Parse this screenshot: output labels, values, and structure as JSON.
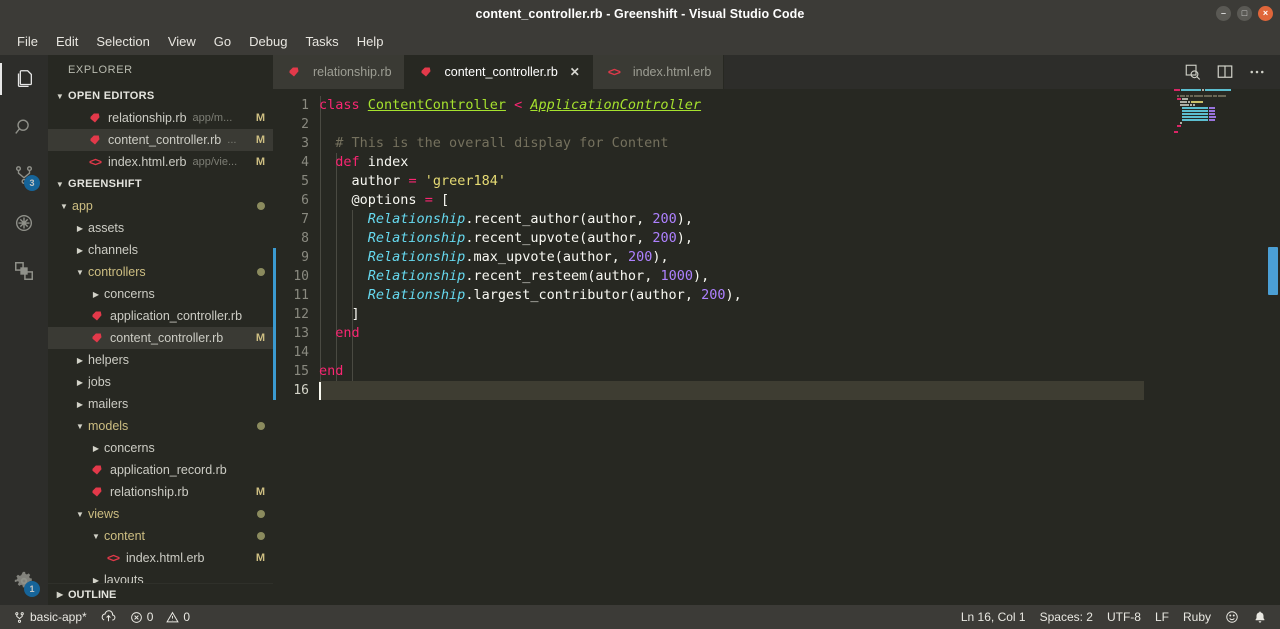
{
  "window": {
    "title": "content_controller.rb - Greenshift - Visual Studio Code",
    "minimize_label": "–",
    "maximize_label": "□",
    "close_label": "×"
  },
  "menubar": {
    "items": [
      "File",
      "Edit",
      "Selection",
      "View",
      "Go",
      "Debug",
      "Tasks",
      "Help"
    ]
  },
  "activitybar": {
    "items": [
      {
        "name": "explorer",
        "icon": "files-icon",
        "badge": ""
      },
      {
        "name": "search",
        "icon": "search-icon",
        "badge": ""
      },
      {
        "name": "source-control",
        "icon": "source-control-icon",
        "badge": "3"
      },
      {
        "name": "debug",
        "icon": "debug-icon",
        "badge": ""
      },
      {
        "name": "extensions",
        "icon": "extensions-icon",
        "badge": ""
      }
    ],
    "settings": {
      "name": "manage",
      "icon": "gear-icon",
      "badge": "1"
    }
  },
  "sidebar": {
    "title": "EXPLORER",
    "open_editors": {
      "label": "OPEN EDITORS",
      "items": [
        {
          "name": "relationship.rb",
          "desc": "app/m...",
          "status": "M",
          "icon": "ruby-icon",
          "selected": false
        },
        {
          "name": "content_controller.rb",
          "desc": "...",
          "status": "M",
          "icon": "ruby-icon",
          "selected": true
        },
        {
          "name": "index.html.erb",
          "desc": "app/vie...",
          "status": "M",
          "icon": "erb-icon",
          "selected": false
        }
      ]
    },
    "project": {
      "label": "GREENSHIFT",
      "tree": [
        {
          "label": "app",
          "indent": 1,
          "type": "folder",
          "expanded": true,
          "status": "",
          "dot": true
        },
        {
          "label": "assets",
          "indent": 2,
          "type": "folder",
          "expanded": false,
          "status": "",
          "dot": false
        },
        {
          "label": "channels",
          "indent": 2,
          "type": "folder",
          "expanded": false,
          "status": "",
          "dot": false
        },
        {
          "label": "controllers",
          "indent": 2,
          "type": "folder",
          "expanded": true,
          "status": "",
          "dot": true
        },
        {
          "label": "concerns",
          "indent": 3,
          "type": "folder",
          "expanded": false,
          "status": "",
          "dot": false
        },
        {
          "label": "application_controller.rb",
          "indent": 3,
          "type": "ruby",
          "expanded": false,
          "status": "",
          "dot": false
        },
        {
          "label": "content_controller.rb",
          "indent": 3,
          "type": "ruby",
          "expanded": false,
          "status": "M",
          "dot": false,
          "selected": true
        },
        {
          "label": "helpers",
          "indent": 2,
          "type": "folder",
          "expanded": false,
          "status": "",
          "dot": false
        },
        {
          "label": "jobs",
          "indent": 2,
          "type": "folder",
          "expanded": false,
          "status": "",
          "dot": false
        },
        {
          "label": "mailers",
          "indent": 2,
          "type": "folder",
          "expanded": false,
          "status": "",
          "dot": false
        },
        {
          "label": "models",
          "indent": 2,
          "type": "folder",
          "expanded": true,
          "status": "",
          "dot": true
        },
        {
          "label": "concerns",
          "indent": 3,
          "type": "folder",
          "expanded": false,
          "status": "",
          "dot": false
        },
        {
          "label": "application_record.rb",
          "indent": 3,
          "type": "ruby",
          "expanded": false,
          "status": "",
          "dot": false
        },
        {
          "label": "relationship.rb",
          "indent": 3,
          "type": "ruby",
          "expanded": false,
          "status": "M",
          "dot": false
        },
        {
          "label": "views",
          "indent": 2,
          "type": "folder",
          "expanded": true,
          "status": "",
          "dot": true
        },
        {
          "label": "content",
          "indent": 3,
          "type": "folder",
          "expanded": true,
          "status": "",
          "dot": true
        },
        {
          "label": "index.html.erb",
          "indent": 4,
          "type": "erb",
          "expanded": false,
          "status": "M",
          "dot": false
        },
        {
          "label": "layouts",
          "indent": 3,
          "type": "folder",
          "expanded": false,
          "status": "",
          "dot": false
        }
      ]
    },
    "outline": {
      "label": "OUTLINE"
    }
  },
  "tabs": {
    "items": [
      {
        "label": "relationship.rb",
        "icon": "ruby-icon",
        "active": false,
        "dirty": false
      },
      {
        "label": "content_controller.rb",
        "icon": "ruby-icon",
        "active": true,
        "dirty": false,
        "close": "✕"
      },
      {
        "label": "index.html.erb",
        "icon": "erb-icon",
        "active": false,
        "dirty": false
      }
    ],
    "actions": [
      {
        "name": "open-preview-icon",
        "title": "Open Preview"
      },
      {
        "name": "split-editor-icon",
        "title": "Split Editor"
      },
      {
        "name": "more-actions-icon",
        "title": "More Actions..."
      }
    ]
  },
  "editor": {
    "line_numbers": [
      "1",
      "2",
      "3",
      "4",
      "5",
      "6",
      "7",
      "8",
      "9",
      "10",
      "11",
      "12",
      "13",
      "14",
      "15",
      "16"
    ],
    "current_line": 16,
    "lines": [
      "class ContentController < ApplicationController",
      "",
      "  # This is the overall display for Content",
      "  def index",
      "    author = 'greer184'",
      "    @options = [",
      "      Relationship.recent_author(author, 200),",
      "      Relationship.recent_upvote(author, 200),",
      "      Relationship.max_upvote(author, 200),",
      "      Relationship.recent_resteem(author, 1000),",
      "      Relationship.largest_contributor(author, 200),",
      "    ]",
      "  end",
      "",
      "end",
      ""
    ],
    "language": "Ruby"
  },
  "statusbar": {
    "branch": "basic-app*",
    "branch_icon": "source-control-icon",
    "sync_icon": "sync-icon",
    "errors": "0",
    "warnings": "0",
    "error_icon": "error-icon",
    "warning_icon": "warning-icon",
    "position": "Ln 16, Col 1",
    "indentation": "Spaces: 2",
    "encoding": "UTF-8",
    "eol": "LF",
    "language": "Ruby",
    "feedback_icon": "smiley-icon",
    "notifications_icon": "bell-icon"
  },
  "colors": {
    "titlebar_bg": "#3c3b37",
    "editor_bg": "#272822",
    "sidebar_bg": "#272822",
    "activitybar_bg": "#2d2d2a",
    "badge_blue": "#0e7ac4",
    "ruby_red": "#e3394a",
    "keyword_pink": "#f92672",
    "class_green": "#a6e22e",
    "type_cyan": "#66d9ef",
    "string_yellow": "#e6db74",
    "number_purple": "#ae81ff",
    "comment_gray": "#75715e",
    "modified_khaki": "#cdbe82",
    "close_button": "#e0663a"
  }
}
